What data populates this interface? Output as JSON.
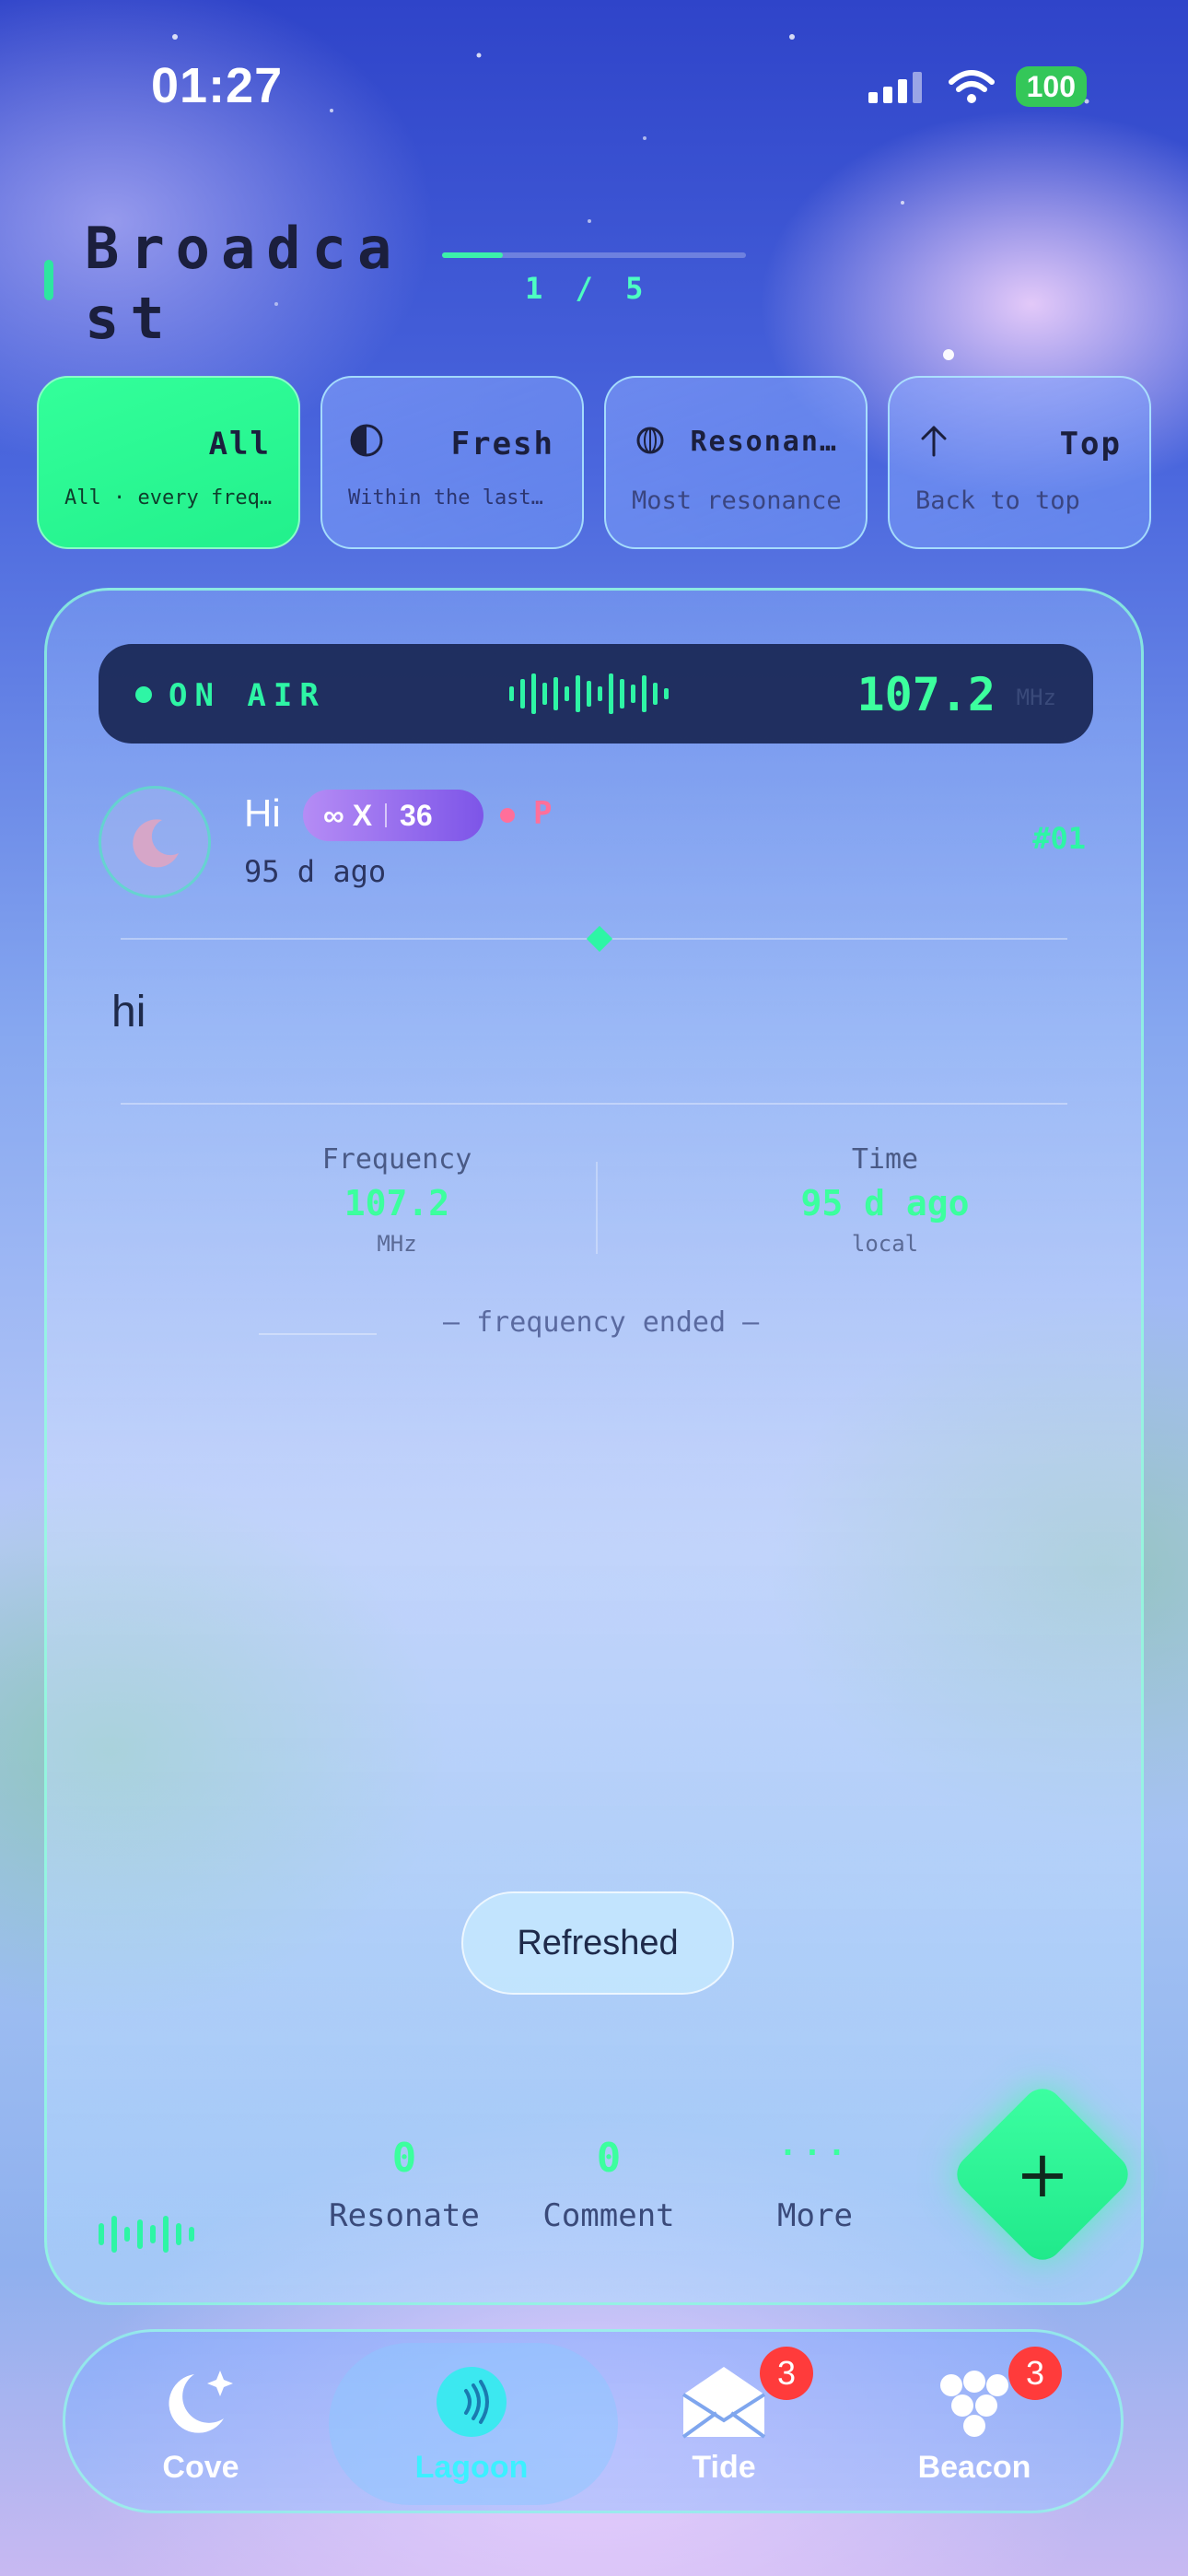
{
  "status_bar": {
    "time": "01:27",
    "battery": "100"
  },
  "header": {
    "title": "Broadcast",
    "page_indicator": "1 / 5",
    "page_progress": 0.2
  },
  "filters": [
    {
      "label": "All",
      "subtitle": "All · every freq…",
      "active": true,
      "icon": "none"
    },
    {
      "label": "Fresh",
      "subtitle": "Within the last…",
      "active": false,
      "icon": "half-circle-icon"
    },
    {
      "label": "Resonan…",
      "subtitle": "Most resonance",
      "active": false,
      "icon": "globe-icon"
    },
    {
      "label": "Top",
      "subtitle": "Back to top",
      "active": false,
      "icon": "arrow-up-icon"
    }
  ],
  "on_air": {
    "label": "ON AIR",
    "frequency": "107.2",
    "unit": "MHz"
  },
  "post": {
    "username": "Hi",
    "badge_symbol": "∞ X",
    "badge_level": "36",
    "tag": "P",
    "time": "95 d ago",
    "number": "#01",
    "body": "hi",
    "stats": {
      "frequency_label": "Frequency",
      "frequency_value": "107.2",
      "frequency_unit": "MHz",
      "time_label": "Time",
      "time_value": "95 d ago",
      "time_unit": "local"
    },
    "ended_text": "— frequency ended —"
  },
  "toast": "Refreshed",
  "actions": {
    "resonate_count": "0",
    "resonate_label": "Resonate",
    "comment_count": "0",
    "comment_label": "Comment",
    "more_dots": "···",
    "more_label": "More"
  },
  "fab_label": "+",
  "tabs": [
    {
      "label": "Cove",
      "active": false,
      "badge": ""
    },
    {
      "label": "Lagoon",
      "active": true,
      "badge": ""
    },
    {
      "label": "Tide",
      "active": false,
      "badge": "3"
    },
    {
      "label": "Beacon",
      "active": false,
      "badge": "3"
    }
  ],
  "colors": {
    "accent": "#2ef5a5",
    "badge": "#ff3b3b",
    "level_badge": "#7d55e8",
    "tag": "#ff6f9a"
  }
}
